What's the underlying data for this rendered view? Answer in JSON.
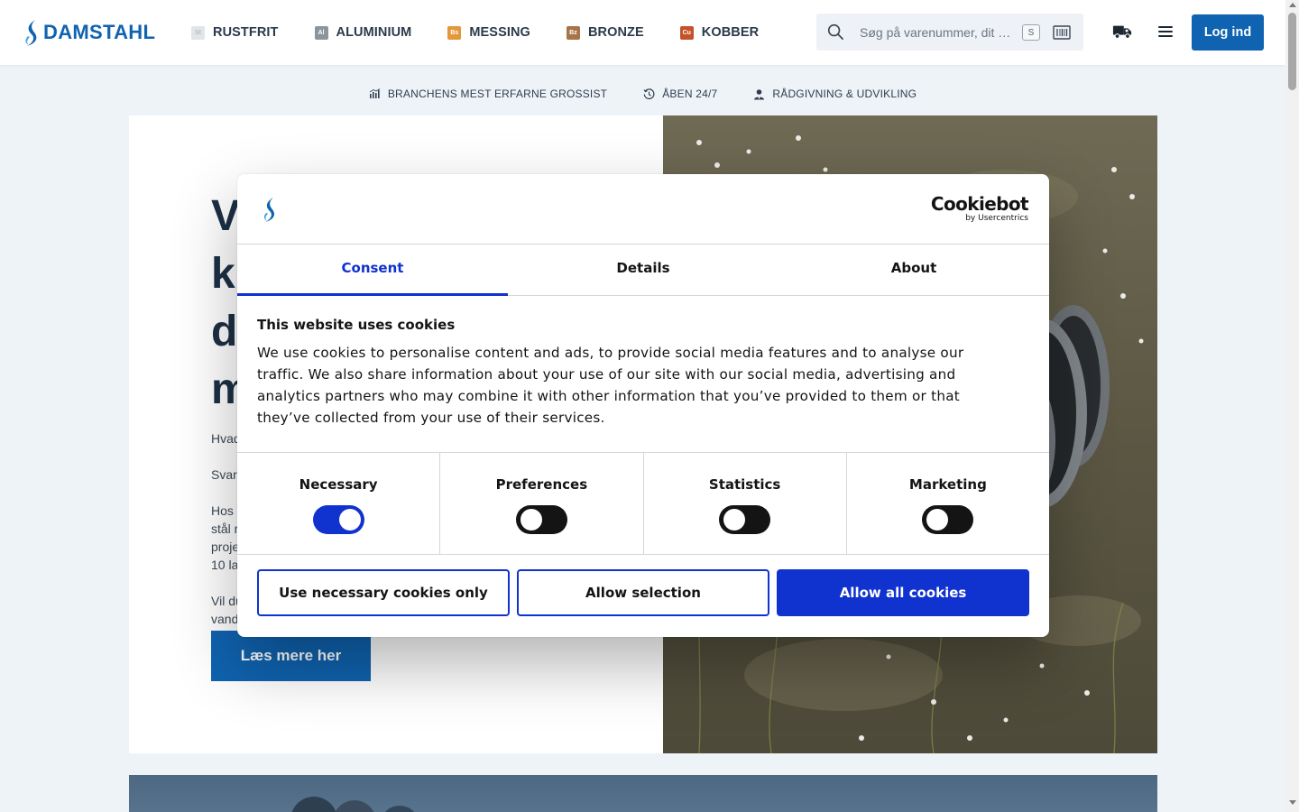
{
  "header": {
    "logo_text": "DAMSTAHL",
    "nav": [
      {
        "badge": "St",
        "label": "RUSTFRIT",
        "color": "#dfe3e7"
      },
      {
        "badge": "Al",
        "label": "ALUMINIUM",
        "color": "#8c949c"
      },
      {
        "badge": "Bs",
        "label": "MESSING",
        "color": "#e3983a"
      },
      {
        "badge": "Bz",
        "label": "BRONZE",
        "color": "#a67448"
      },
      {
        "badge": "Cu",
        "label": "KOBBER",
        "color": "#c4532b"
      }
    ],
    "search_placeholder": "Søg på varenummer, dit …",
    "search_shortcut": "S",
    "login_label": "Log ind"
  },
  "usp": [
    {
      "icon": "chart-icon",
      "label": "BRANCHENS MEST ERFARNE GROSSIST"
    },
    {
      "icon": "clock-icon",
      "label": "ÅBEN 24/7"
    },
    {
      "icon": "advisor-icon",
      "label": "RÅDGIVNING & UDVIKLING"
    }
  ],
  "hero": {
    "title": "V\nkr\nde\nm",
    "paragraphs": [
      "Hvad",
      "Svare",
      "Hos\nstål r\nproje\n10 la",
      "Vil du\nvand\nløsni"
    ],
    "cta": "Læs mere her"
  },
  "cookie": {
    "brand_name": "Cookiebot",
    "brand_sub": "by Usercentrics",
    "tabs": [
      "Consent",
      "Details",
      "About"
    ],
    "active_tab": "Consent",
    "heading": "This website uses cookies",
    "text": "We use cookies to personalise content and ads, to provide social media features and to analyse our traffic. We also share information about your use of our site with our social media, advertising and analytics partners who may combine it with other information that you’ve provided to them or that they’ve collected from your use of their services.",
    "categories": [
      {
        "label": "Necessary",
        "on": true
      },
      {
        "label": "Preferences",
        "on": false
      },
      {
        "label": "Statistics",
        "on": false
      },
      {
        "label": "Marketing",
        "on": false
      }
    ],
    "buttons": {
      "necessary_only": "Use necessary cookies only",
      "allow_selection": "Allow selection",
      "allow_all": "Allow all cookies"
    }
  },
  "colors": {
    "brand_blue": "#0f63b0",
    "cookiebot_blue": "#1032cf",
    "page_bg": "#eef3f8"
  }
}
